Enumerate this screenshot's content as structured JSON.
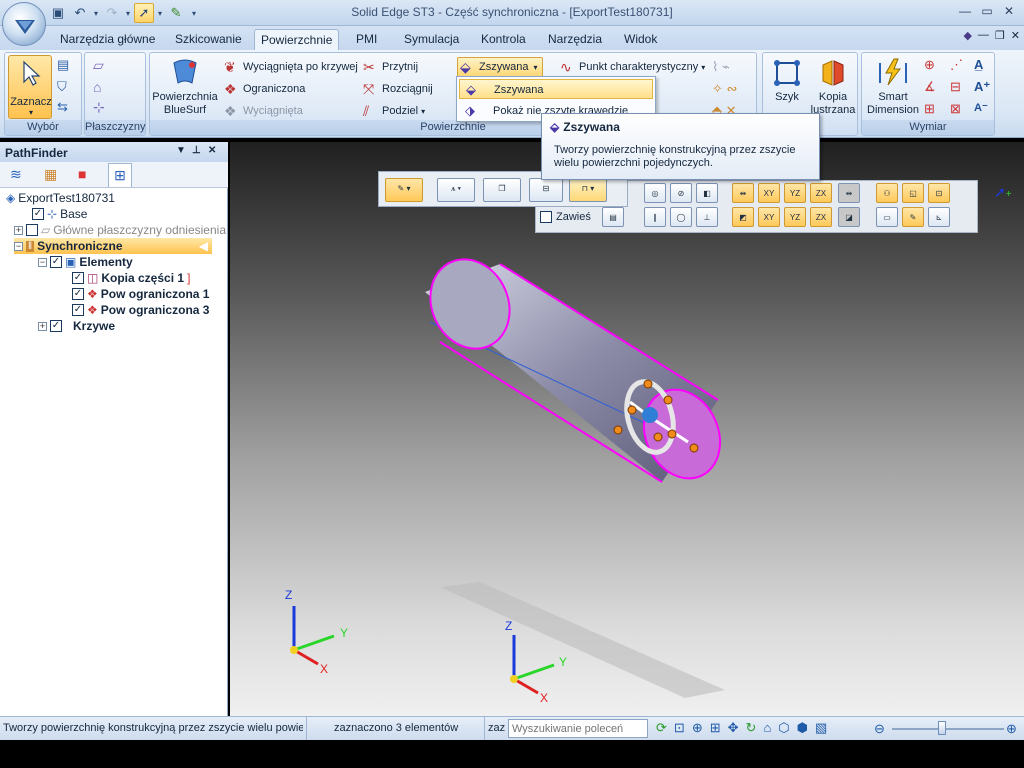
{
  "app": {
    "title": "Solid Edge ST3 - Część synchroniczna - [ExportTest180731]"
  },
  "tabs": [
    "Narzędzia główne",
    "Szkicowanie",
    "Powierzchnie",
    "PMI",
    "Symulacja",
    "Kontrola",
    "Narzędzia",
    "Widok"
  ],
  "ribbon": {
    "select": {
      "label": "Zaznacz",
      "group": "Wybór"
    },
    "planes_group": "Płaszczyzny",
    "surfaces": {
      "bluesurf_line1": "Powierzchnia",
      "bluesurf_line2": "BlueSurf",
      "swept_curve": "Wyciągnięta po krzywej",
      "bounded": "Ograniczona",
      "extruded": "Wyciągnięta",
      "trim": "Przytnij",
      "extend": "Rozciągnij",
      "split": "Podziel",
      "stitched": "Zszywana",
      "keypoint": "Punkt charakterystyczny",
      "group": "Powierzchnie"
    },
    "quick": {
      "label": "Szyk"
    },
    "mirror": {
      "line1": "Kopia",
      "line2": "lustrzana"
    },
    "dimension": {
      "line1": "Smart",
      "line2": "Dimension",
      "group": "Wymiar"
    }
  },
  "dropdown": {
    "item1": "Zszywana",
    "item2": "Pokaż nie zszyte krawędzie"
  },
  "tooltip": {
    "title": "Zszywana",
    "body_line1": "Tworzy powierzchnię konstrukcyjną przez zszycie",
    "body_line2": "wielu powierzchni pojedynczych."
  },
  "pathfinder": {
    "title": "PathFinder",
    "root": "ExportTest180731",
    "base": "Base",
    "planes": "Główne płaszczyzny odniesienia",
    "sync": "Synchroniczne",
    "elements": "Elementy",
    "items": [
      "Kopia części 1",
      "Pow ograniczona 1",
      "Pow ograniczona 3"
    ],
    "curves": "Krzywe"
  },
  "viewport": {
    "hang_label": "Zawieś",
    "axis_x": "X",
    "axis_y": "Y",
    "axis_z": "Z"
  },
  "status": {
    "message": "Tworzy powierzchnię konstrukcyjną przez zszycie wielu powier.",
    "selection": "zaznaczono 3 elementów",
    "zaz": "zaz",
    "search_placeholder": "Wyszukiwanie poleceń"
  },
  "colors": {
    "accent": "#ffc95a",
    "selection_magenta": "#ff00ff",
    "ribbon_bg": "#dbe7f5"
  }
}
